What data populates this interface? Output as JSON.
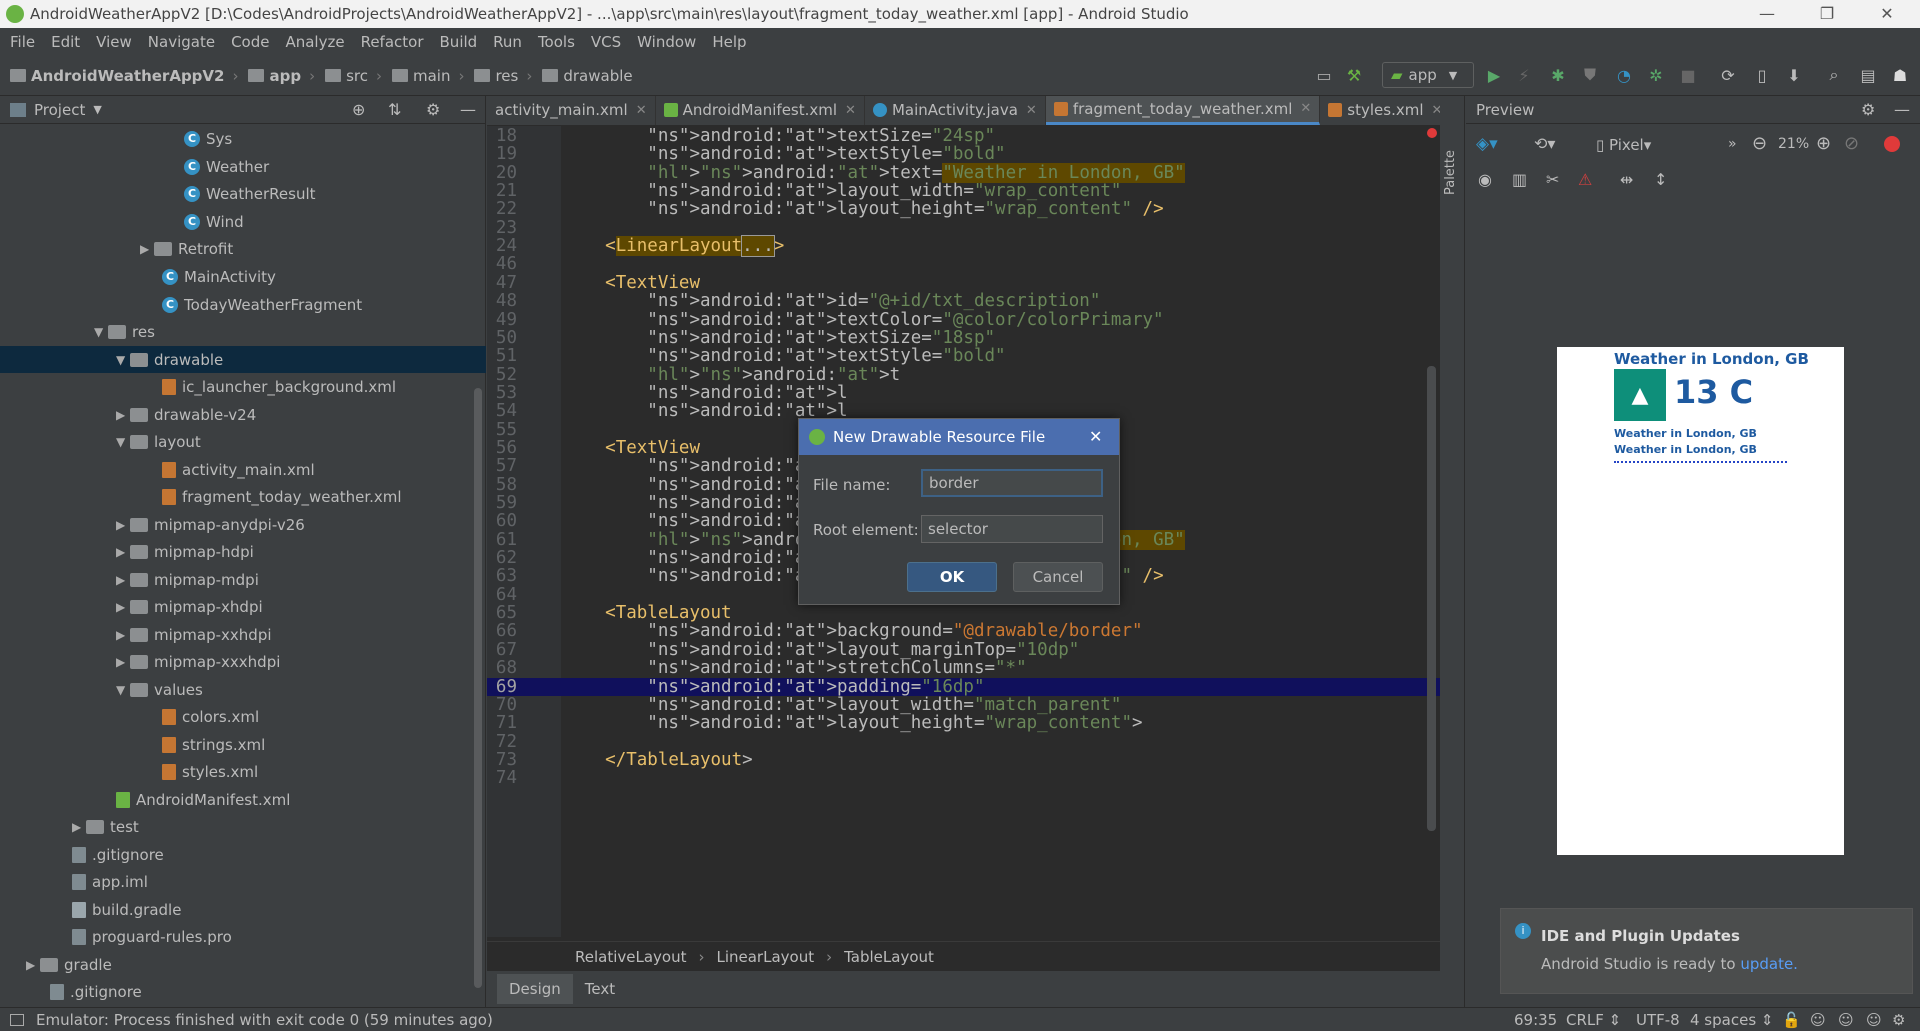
{
  "window": {
    "title": "AndroidWeatherAppV2 [D:\\Codes\\AndroidProjects\\AndroidWeatherAppV2] - ...\\app\\src\\main\\res\\layout\\fragment_today_weather.xml [app] - Android Studio",
    "minimize": "—",
    "maximize": "❐",
    "close": "✕"
  },
  "menu": [
    "File",
    "Edit",
    "View",
    "Navigate",
    "Code",
    "Analyze",
    "Refactor",
    "Build",
    "Run",
    "Tools",
    "VCS",
    "Window",
    "Help"
  ],
  "breadcrumb": [
    "AndroidWeatherAppV2",
    "app",
    "src",
    "main",
    "res",
    "drawable"
  ],
  "toolbar": {
    "run_config": "app"
  },
  "project_panel": {
    "title": "Project",
    "tree": [
      {
        "label": "Sys",
        "kind": "class"
      },
      {
        "label": "Weather",
        "kind": "class"
      },
      {
        "label": "WeatherResult",
        "kind": "class"
      },
      {
        "label": "Wind",
        "kind": "class"
      },
      {
        "label": "Retrofit",
        "kind": "folder"
      },
      {
        "label": "MainActivity",
        "kind": "class"
      },
      {
        "label": "TodayWeatherFragment",
        "kind": "class"
      },
      {
        "label": "res",
        "kind": "folder"
      },
      {
        "label": "drawable",
        "kind": "folder",
        "selected": true
      },
      {
        "label": "ic_launcher_background.xml",
        "kind": "xml"
      },
      {
        "label": "drawable-v24",
        "kind": "folder"
      },
      {
        "label": "layout",
        "kind": "folder"
      },
      {
        "label": "activity_main.xml",
        "kind": "xml"
      },
      {
        "label": "fragment_today_weather.xml",
        "kind": "xml"
      },
      {
        "label": "mipmap-anydpi-v26",
        "kind": "folder"
      },
      {
        "label": "mipmap-hdpi",
        "kind": "folder"
      },
      {
        "label": "mipmap-mdpi",
        "kind": "folder"
      },
      {
        "label": "mipmap-xhdpi",
        "kind": "folder"
      },
      {
        "label": "mipmap-xxhdpi",
        "kind": "folder"
      },
      {
        "label": "mipmap-xxxhdpi",
        "kind": "folder"
      },
      {
        "label": "values",
        "kind": "folder"
      },
      {
        "label": "colors.xml",
        "kind": "xml"
      },
      {
        "label": "strings.xml",
        "kind": "xml"
      },
      {
        "label": "styles.xml",
        "kind": "xml"
      },
      {
        "label": "AndroidManifest.xml",
        "kind": "xml"
      },
      {
        "label": "test",
        "kind": "folder"
      },
      {
        "label": ".gitignore",
        "kind": "file"
      },
      {
        "label": "app.iml",
        "kind": "file"
      },
      {
        "label": "build.gradle",
        "kind": "file"
      },
      {
        "label": "proguard-rules.pro",
        "kind": "file"
      },
      {
        "label": "gradle",
        "kind": "folder"
      },
      {
        "label": ".gitignore",
        "kind": "file"
      }
    ]
  },
  "editor_tabs": [
    {
      "label": "activity_main.xml",
      "active": false
    },
    {
      "label": "AndroidManifest.xml",
      "active": false
    },
    {
      "label": "MainActivity.java",
      "active": false
    },
    {
      "label": "fragment_today_weather.xml",
      "active": true
    },
    {
      "label": "styles.xml",
      "active": false
    }
  ],
  "code_lines": [
    {
      "n": "18",
      "text": "        android:textSize=\"24sp\""
    },
    {
      "n": "19",
      "text": "        android:textStyle=\"bold\""
    },
    {
      "n": "20",
      "text": "        android:text=\"Weather in London, GB\""
    },
    {
      "n": "21",
      "text": "        android:layout_width=\"wrap_content\""
    },
    {
      "n": "22",
      "text": "        android:layout_height=\"wrap_content\" />"
    },
    {
      "n": "23",
      "text": ""
    },
    {
      "n": "24",
      "text": "    <LinearLayout...>"
    },
    {
      "n": "46",
      "text": ""
    },
    {
      "n": "47",
      "text": "    <TextView"
    },
    {
      "n": "48",
      "text": "        android:id=\"@+id/txt_description\""
    },
    {
      "n": "49",
      "text": "        android:textColor=\"@color/colorPrimary\""
    },
    {
      "n": "50",
      "text": "        android:textSize=\"18sp\""
    },
    {
      "n": "51",
      "text": "        android:textStyle=\"bold\""
    },
    {
      "n": "52",
      "text": "        android:t"
    },
    {
      "n": "53",
      "text": "        android:l"
    },
    {
      "n": "54",
      "text": "        android:l"
    },
    {
      "n": "55",
      "text": ""
    },
    {
      "n": "56",
      "text": "    <TextView"
    },
    {
      "n": "57",
      "text": "        android:i"
    },
    {
      "n": "58",
      "text": "        android:t"
    },
    {
      "n": "59",
      "text": "        android:t"
    },
    {
      "n": "60",
      "text": "        android:textStyle=\"bold\""
    },
    {
      "n": "61",
      "text": "        android:text=\"Weather in London, GB\""
    },
    {
      "n": "62",
      "text": "        android:layout_width=\"wrap_content\""
    },
    {
      "n": "63",
      "text": "        android:layout_height=\"wrap_content\" />"
    },
    {
      "n": "64",
      "text": ""
    },
    {
      "n": "65",
      "text": "    <TableLayout"
    },
    {
      "n": "66",
      "text": "        android:background=\"@drawable/border\""
    },
    {
      "n": "67",
      "text": "        android:layout_marginTop=\"10dp\""
    },
    {
      "n": "68",
      "text": "        android:stretchColumns=\"*\""
    },
    {
      "n": "69",
      "text": "        android:padding=\"16dp\""
    },
    {
      "n": "70",
      "text": "        android:layout_width=\"match_parent\""
    },
    {
      "n": "71",
      "text": "        android:layout_height=\"wrap_content\">"
    },
    {
      "n": "72",
      "text": ""
    },
    {
      "n": "73",
      "text": "    </TableLayout>"
    },
    {
      "n": "74",
      "text": ""
    }
  ],
  "editor_breadcrumb": [
    "RelativeLayout",
    "LinearLayout",
    "TableLayout"
  ],
  "design_tabs": [
    "Design",
    "Text"
  ],
  "preview": {
    "title": "Preview",
    "device": "Pixel",
    "zoom": "21%",
    "palette_label": "Palette",
    "phone": {
      "heading": "Weather in London, GB",
      "temp": "13 C",
      "line1": "Weather in London, GB",
      "line2": "Weather in London, GB"
    }
  },
  "dialog": {
    "title": "New Drawable Resource File",
    "close": "✕",
    "file_name_label": "File name:",
    "file_name_value": "border",
    "root_element_label": "Root element:",
    "root_element_value": "selector",
    "ok": "OK",
    "cancel": "Cancel"
  },
  "notification": {
    "title": "IDE and Plugin Updates",
    "body": "Android Studio is ready to",
    "link": "update."
  },
  "status": {
    "message": "Emulator: Process finished with exit code 0 (59 minutes ago)",
    "position": "69:35",
    "line_sep": "CRLF",
    "encoding": "UTF-8",
    "indent": "4 spaces"
  }
}
